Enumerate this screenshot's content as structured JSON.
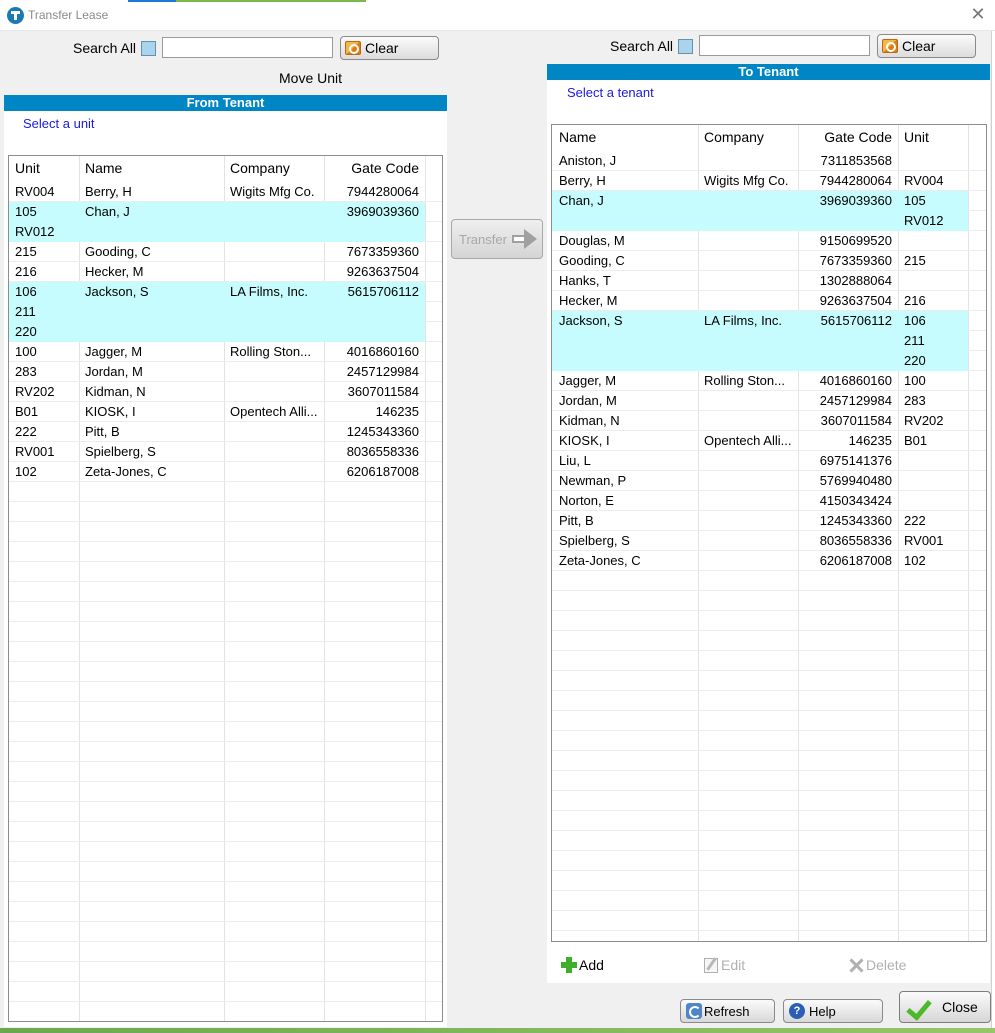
{
  "window": {
    "title": "Transfer Lease"
  },
  "left": {
    "search_label": "Search All",
    "search_value": "",
    "clear_label": "Clear",
    "move_unit_label": "Move Unit",
    "panel_title": "From Tenant",
    "hint": "Select a unit",
    "columns": [
      "Unit",
      "Name",
      "Company",
      "Gate Code"
    ],
    "rows": [
      {
        "unit": "RV004",
        "name": "Berry, H",
        "company": "Wigits Mfg Co.",
        "gate": "7944280064"
      },
      {
        "unit": "105",
        "name": "Chan, J",
        "company": "",
        "gate": "3969039360"
      },
      {
        "unit": "RV012",
        "name": "",
        "company": "",
        "gate": ""
      },
      {
        "unit": "215",
        "name": "Gooding, C",
        "company": "",
        "gate": "7673359360"
      },
      {
        "unit": "216",
        "name": "Hecker, M",
        "company": "",
        "gate": "9263637504"
      },
      {
        "unit": "106",
        "name": "Jackson, S",
        "company": "LA Films, Inc.",
        "gate": "5615706112"
      },
      {
        "unit": "211",
        "name": "",
        "company": "",
        "gate": ""
      },
      {
        "unit": "220",
        "name": "",
        "company": "",
        "gate": ""
      },
      {
        "unit": "100",
        "name": "Jagger, M",
        "company": "Rolling Ston...",
        "gate": "4016860160"
      },
      {
        "unit": "283",
        "name": "Jordan, M",
        "company": "",
        "gate": "2457129984"
      },
      {
        "unit": "RV202",
        "name": "Kidman, N",
        "company": "",
        "gate": "3607011584"
      },
      {
        "unit": "B01",
        "name": "KIOSK, I",
        "company": "Opentech Alli...",
        "gate": "146235"
      },
      {
        "unit": "222",
        "name": "Pitt, B",
        "company": "",
        "gate": "1245343360"
      },
      {
        "unit": "RV001",
        "name": "Spielberg, S",
        "company": "",
        "gate": "8036558336"
      },
      {
        "unit": "102",
        "name": "Zeta-Jones, C",
        "company": "",
        "gate": "6206187008"
      }
    ]
  },
  "transfer_label": "Transfer",
  "right": {
    "search_label": "Search All",
    "search_value": "",
    "clear_label": "Clear",
    "panel_title": "To Tenant",
    "hint": "Select a tenant",
    "columns": [
      "Name",
      "Company",
      "Gate Code",
      "Unit"
    ],
    "rows": [
      {
        "name": "Aniston, J",
        "company": "",
        "gate": "7311853568",
        "unit": ""
      },
      {
        "name": "Berry, H",
        "company": "Wigits Mfg Co.",
        "gate": "7944280064",
        "unit": "RV004"
      },
      {
        "name": "Chan, J",
        "company": "",
        "gate": "3969039360",
        "unit": "105"
      },
      {
        "name": "",
        "company": "",
        "gate": "",
        "unit": "RV012"
      },
      {
        "name": "Douglas, M",
        "company": "",
        "gate": "9150699520",
        "unit": ""
      },
      {
        "name": "Gooding, C",
        "company": "",
        "gate": "7673359360",
        "unit": "215"
      },
      {
        "name": "Hanks, T",
        "company": "",
        "gate": "1302888064",
        "unit": ""
      },
      {
        "name": "Hecker, M",
        "company": "",
        "gate": "9263637504",
        "unit": "216"
      },
      {
        "name": "Jackson, S",
        "company": "LA Films, Inc.",
        "gate": "5615706112",
        "unit": "106"
      },
      {
        "name": "",
        "company": "",
        "gate": "",
        "unit": "211"
      },
      {
        "name": "",
        "company": "",
        "gate": "",
        "unit": "220"
      },
      {
        "name": "Jagger, M",
        "company": "Rolling Ston...",
        "gate": "4016860160",
        "unit": "100"
      },
      {
        "name": "Jordan, M",
        "company": "",
        "gate": "2457129984",
        "unit": "283"
      },
      {
        "name": "Kidman, N",
        "company": "",
        "gate": "3607011584",
        "unit": "RV202"
      },
      {
        "name": "KIOSK, I",
        "company": "Opentech Alli...",
        "gate": "146235",
        "unit": "B01"
      },
      {
        "name": "Liu, L",
        "company": "",
        "gate": "6975141376",
        "unit": ""
      },
      {
        "name": "Newman, P",
        "company": "",
        "gate": "5769940480",
        "unit": ""
      },
      {
        "name": "Norton, E",
        "company": "",
        "gate": "4150343424",
        "unit": ""
      },
      {
        "name": "Pitt, B",
        "company": "",
        "gate": "1245343360",
        "unit": "222"
      },
      {
        "name": "Spielberg, S",
        "company": "",
        "gate": "8036558336",
        "unit": "RV001"
      },
      {
        "name": "Zeta-Jones, C",
        "company": "",
        "gate": "6206187008",
        "unit": "102"
      }
    ],
    "add_label": "Add",
    "edit_label": "Edit",
    "delete_label": "Delete"
  },
  "footer": {
    "refresh_label": "Refresh",
    "help_label": "Help",
    "close_label": "Close"
  },
  "colors": {
    "header_bar": "#0086c4",
    "selected_row": "#c6fcfd",
    "hint_text": "#1a1adf"
  },
  "selection": {
    "left_selected_rows": [
      1,
      2,
      5,
      6,
      7
    ],
    "right_selected_rows": [
      2,
      3,
      8,
      9,
      10
    ]
  }
}
